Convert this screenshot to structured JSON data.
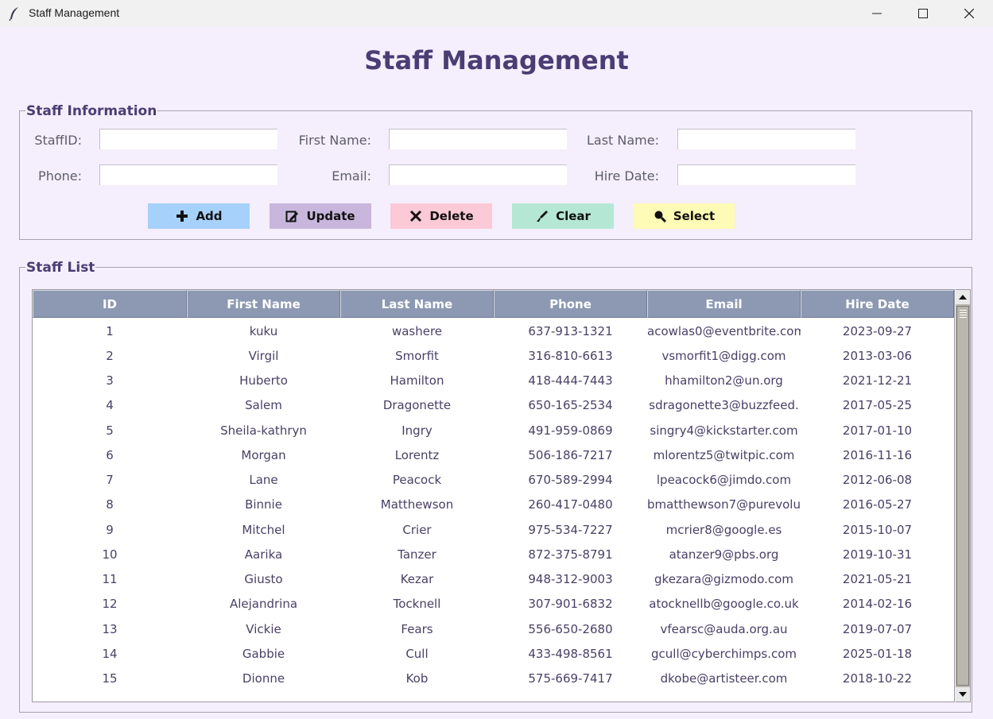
{
  "window": {
    "title": "Staff Management"
  },
  "heading": "Staff Management",
  "form": {
    "legend": "Staff Information",
    "fields": [
      {
        "label": "StaffID:",
        "value": ""
      },
      {
        "label": "First Name:",
        "value": ""
      },
      {
        "label": "Last Name:",
        "value": ""
      },
      {
        "label": "Phone:",
        "value": ""
      },
      {
        "label": "Email:",
        "value": ""
      },
      {
        "label": "Hire Date:",
        "value": ""
      }
    ],
    "buttons": [
      {
        "label": "Add",
        "icon": "plus-icon",
        "color": "#a6d1fb"
      },
      {
        "label": "Update",
        "icon": "edit-icon",
        "color": "#c8b6dc"
      },
      {
        "label": "Delete",
        "icon": "x-icon",
        "color": "#fcc9d7"
      },
      {
        "label": "Clear",
        "icon": "brush-icon",
        "color": "#b5e8d4"
      },
      {
        "label": "Select",
        "icon": "search-icon",
        "color": "#fdfbb5"
      }
    ]
  },
  "list": {
    "legend": "Staff List",
    "columns": [
      "ID",
      "First Name",
      "Last Name",
      "Phone",
      "Email",
      "Hire Date"
    ],
    "rows": [
      [
        "1",
        "kuku",
        "washere",
        "637-913-1321",
        "acowlas0@eventbrite.com",
        "2023-09-27"
      ],
      [
        "2",
        "Virgil",
        "Smorfit",
        "316-810-6613",
        "vsmorfit1@digg.com",
        "2013-03-06"
      ],
      [
        "3",
        "Huberto",
        "Hamilton",
        "418-444-7443",
        "hhamilton2@un.org",
        "2021-12-21"
      ],
      [
        "4",
        "Salem",
        "Dragonette",
        "650-165-2534",
        "sdragonette3@buzzfeed.",
        "2017-05-25"
      ],
      [
        "5",
        "Sheila-kathryn",
        "Ingry",
        "491-959-0869",
        "singry4@kickstarter.com",
        "2017-01-10"
      ],
      [
        "6",
        "Morgan",
        "Lorentz",
        "506-186-7217",
        "mlorentz5@twitpic.com",
        "2016-11-16"
      ],
      [
        "7",
        "Lane",
        "Peacock",
        "670-589-2994",
        "lpeacock6@jimdo.com",
        "2012-06-08"
      ],
      [
        "8",
        "Binnie",
        "Matthewson",
        "260-417-0480",
        "bmatthewson7@purevolu",
        "2016-05-27"
      ],
      [
        "9",
        "Mitchel",
        "Crier",
        "975-534-7227",
        "mcrier8@google.es",
        "2015-10-07"
      ],
      [
        "10",
        "Aarika",
        "Tanzer",
        "872-375-8791",
        "atanzer9@pbs.org",
        "2019-10-31"
      ],
      [
        "11",
        "Giusto",
        "Kezar",
        "948-312-9003",
        "gkezara@gizmodo.com",
        "2021-05-21"
      ],
      [
        "12",
        "Alejandrina",
        "Tocknell",
        "307-901-6832",
        "atocknellb@google.co.uk",
        "2014-02-16"
      ],
      [
        "13",
        "Vickie",
        "Fears",
        "556-650-2680",
        "vfearsc@auda.org.au",
        "2019-07-07"
      ],
      [
        "14",
        "Gabbie",
        "Cull",
        "433-498-8561",
        "gcull@cyberchimps.com",
        "2025-01-18"
      ],
      [
        "15",
        "Dionne",
        "Kob",
        "575-669-7417",
        "dkobe@artisteer.com",
        "2018-10-22"
      ]
    ]
  }
}
